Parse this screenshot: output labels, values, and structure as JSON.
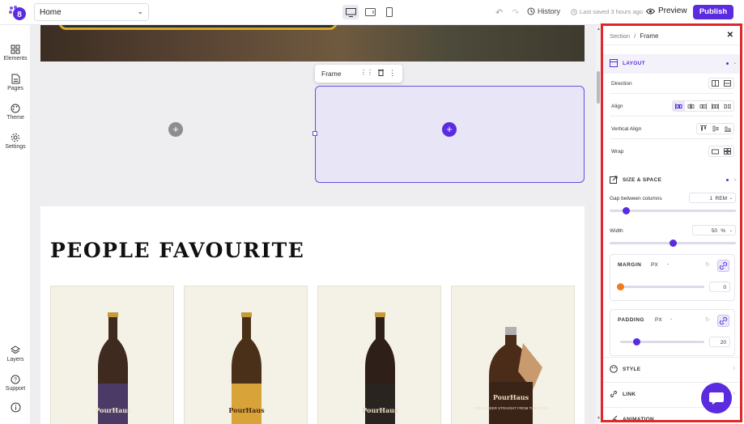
{
  "topbar": {
    "page_name": "Home",
    "history_label": "History",
    "saved_label": "Last saved 3 hours ago",
    "preview_label": "Preview",
    "publish_label": "Publish"
  },
  "leftbar": {
    "elements": "Elements",
    "pages": "Pages",
    "theme": "Theme",
    "settings": "Settings",
    "layers": "Layers",
    "support": "Support"
  },
  "canvas": {
    "frame_tool_label": "Frame",
    "section_title": "PEOPLE FAVOURITE",
    "products": [
      {
        "label": "PourHaus",
        "cap": "#c49a3a",
        "body": "#3e2a1e",
        "label_color": "#4b3a66"
      },
      {
        "label": "PourHaus",
        "cap": "#c49a3a",
        "body": "#4a3018",
        "label_color": "#d8a43a"
      },
      {
        "label": "PourHaus",
        "cap": "#c49a3a",
        "body": "#2e2018",
        "label_color": "#2a2420"
      },
      {
        "label": "PourHaus",
        "cap": "#c49a3a",
        "body": "#4a2c18",
        "label_color": "#3a2418",
        "tag": "FRESH BEER STRAIGHT FROM THE POUR"
      }
    ]
  },
  "panel": {
    "crumb_section": "Section",
    "crumb_sep": "/",
    "crumb_current": "Frame",
    "layout": {
      "title": "LAYOUT",
      "direction_label": "Direction",
      "align_label": "Align",
      "valign_label": "Vertical Align",
      "wrap_label": "Wrap"
    },
    "size_space": {
      "title": "SIZE & SPACE",
      "gap_label": "Gap between columns",
      "gap_value": "1",
      "gap_unit": "REM",
      "gap_level": 0.13,
      "width_label": "Width",
      "width_value": "50",
      "width_unit": "%",
      "width_level": 0.5
    },
    "margin": {
      "title": "MARGIN",
      "unit": "PX",
      "value": "0",
      "level": 0.0
    },
    "padding": {
      "title": "PADDING",
      "unit": "PX",
      "value": "20",
      "level": 0.2
    },
    "sections": [
      "STYLE",
      "LINK",
      "ANIMATION"
    ]
  },
  "colors": {
    "accent": "#5b2be0",
    "highlight": "#e1262b",
    "orange": "#f07b1b"
  }
}
